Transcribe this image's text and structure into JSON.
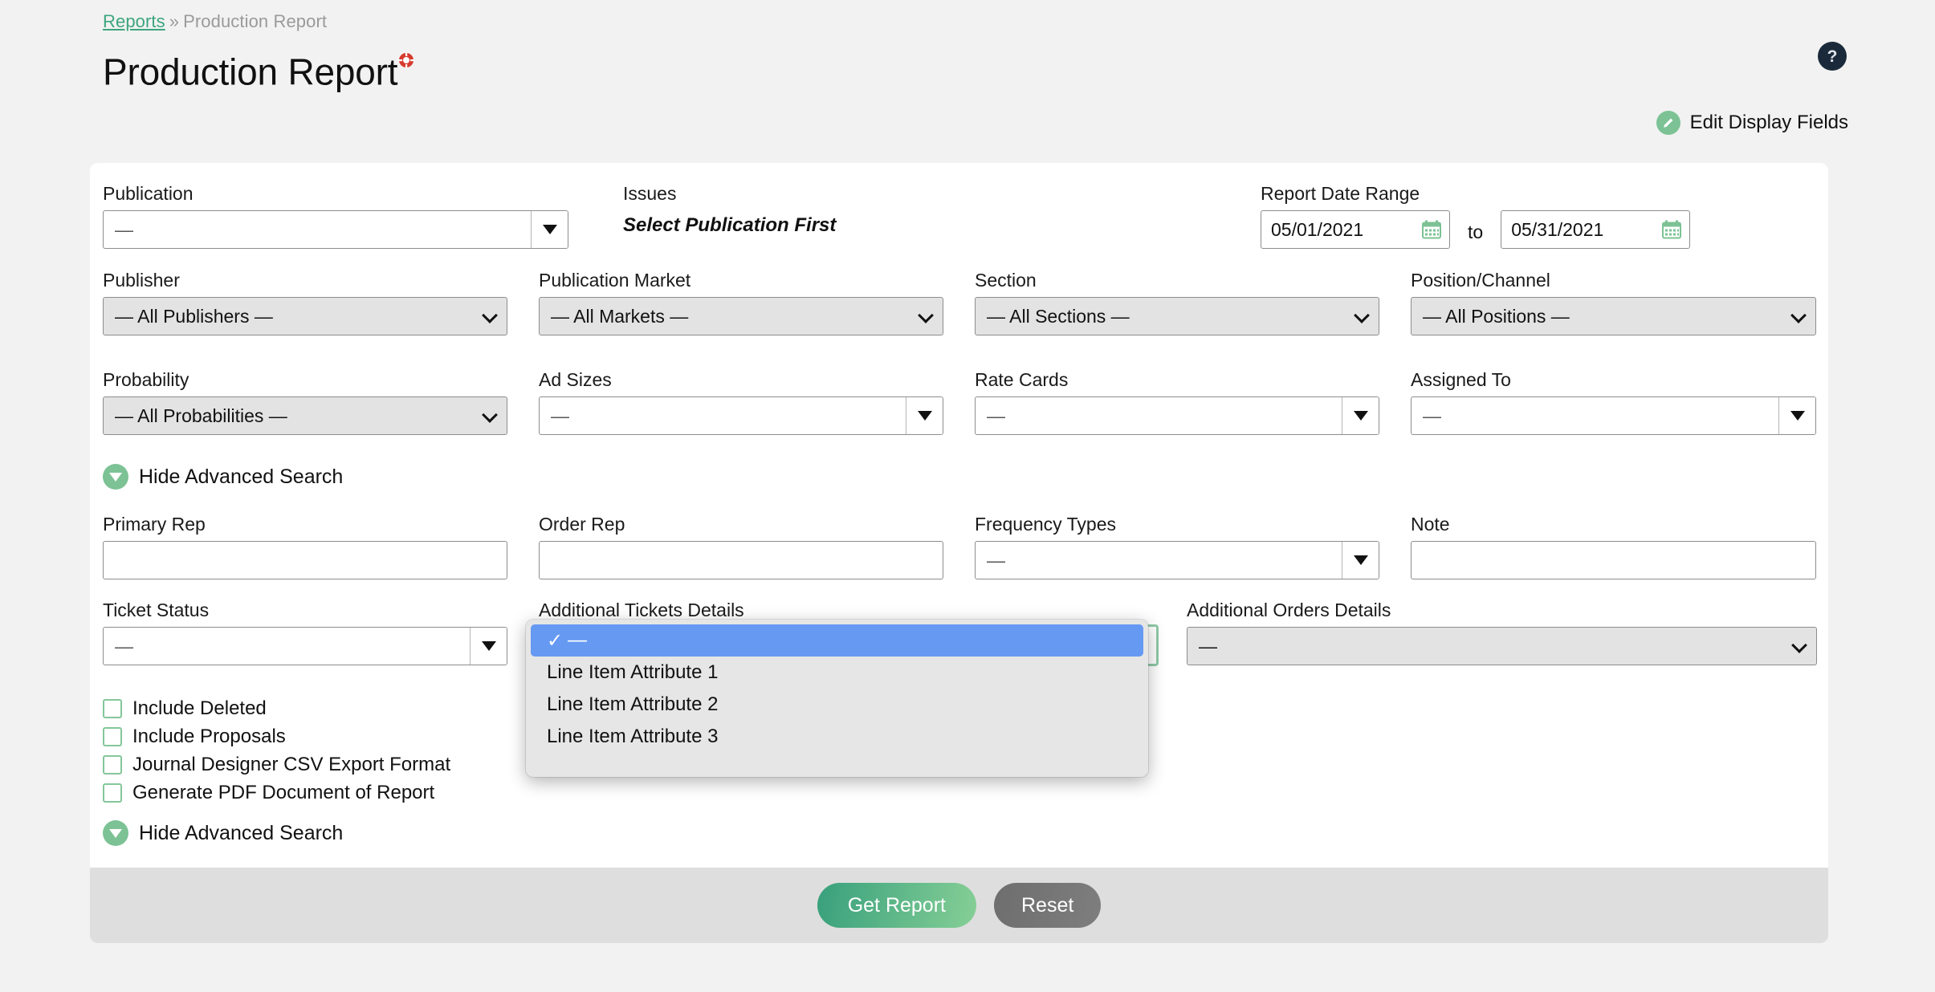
{
  "breadcrumb": {
    "link": "Reports",
    "separator": "»",
    "current": "Production Report"
  },
  "page_title": "Production Report",
  "header": {
    "help_icon": "question-mark-icon",
    "help_label": "?",
    "lifebuoy_icon": "lifebuoy-icon",
    "edit_display_fields": "Edit Display Fields",
    "edit_icon": "pencil-icon"
  },
  "colors": {
    "page_bg": "#f2f2f2",
    "card_bg": "#ffffff",
    "footer_bg": "#dedede",
    "accent_green": "#7cc295",
    "link_green": "#3da57f",
    "primary_btn_from": "#38a07c",
    "primary_btn_to": "#86cf96",
    "secondary_btn": "#7e7e7e",
    "help_badge": "#1b2a3a",
    "highlight_blue": "#6699f2",
    "popup_bg": "#e6e6e6",
    "select_bg": "#e3e3e3",
    "focus_ring": "#8fc9a6"
  },
  "form": {
    "publication": {
      "label": "Publication",
      "value": "—"
    },
    "issues": {
      "label": "Issues",
      "note": "Select Publication First"
    },
    "report_date_range": {
      "label": "Report Date Range",
      "from": "05/01/2021",
      "to_word": "to",
      "to": "05/31/2021",
      "calendar_icon": "calendar-icon"
    },
    "publisher": {
      "label": "Publisher",
      "value": "— All Publishers —"
    },
    "publication_market": {
      "label": "Publication Market",
      "value": "— All Markets —"
    },
    "section": {
      "label": "Section",
      "value": "— All Sections —"
    },
    "position_channel": {
      "label": "Position/Channel",
      "value": "— All Positions —"
    },
    "probability": {
      "label": "Probability",
      "value": "— All Probabilities —"
    },
    "ad_sizes": {
      "label": "Ad Sizes",
      "value": "—"
    },
    "rate_cards": {
      "label": "Rate Cards",
      "value": "—"
    },
    "assigned_to": {
      "label": "Assigned To",
      "value": "—"
    },
    "primary_rep": {
      "label": "Primary Rep",
      "value": ""
    },
    "order_rep": {
      "label": "Order Rep",
      "value": ""
    },
    "frequency_types": {
      "label": "Frequency Types",
      "value": "—"
    },
    "note": {
      "label": "Note",
      "value": ""
    },
    "ticket_status": {
      "label": "Ticket Status",
      "value": "—"
    },
    "additional_tickets_details": {
      "label": "Additional Tickets Details",
      "value": "—"
    },
    "additional_orders_details": {
      "label": "Additional Orders Details",
      "value": "—"
    }
  },
  "advanced_toggle_top": {
    "label": "Hide Advanced Search",
    "icon": "chevron-down-circle-icon"
  },
  "advanced_toggle_bottom": {
    "label": "Hide Advanced Search",
    "icon": "chevron-down-circle-icon"
  },
  "checkboxes": [
    {
      "label": "Include Deleted",
      "checked": false
    },
    {
      "label": "Include Proposals",
      "checked": false
    },
    {
      "label": "Journal Designer CSV Export Format",
      "checked": false
    },
    {
      "label": "Generate PDF Document of Report",
      "checked": false
    }
  ],
  "dropdown_popup": {
    "for_field": "Additional Tickets Details",
    "check_glyph": "✓",
    "items": [
      {
        "label": "—",
        "selected": true
      },
      {
        "label": "Line Item Attribute 1",
        "selected": false
      },
      {
        "label": "Line Item Attribute 2",
        "selected": false
      },
      {
        "label": "Line Item Attribute 3",
        "selected": false
      }
    ]
  },
  "footer": {
    "get_report": "Get Report",
    "reset": "Reset"
  }
}
